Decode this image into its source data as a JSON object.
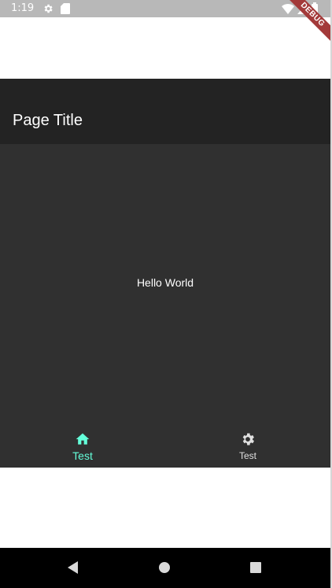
{
  "status_bar": {
    "time": "1:19",
    "icons": [
      "gear-icon",
      "sd-card-icon",
      "wifi-icon",
      "signal-icon",
      "battery-icon"
    ]
  },
  "debug_banner": {
    "label": "DEBUG",
    "color": "#a33a3a"
  },
  "app_bar": {
    "title": "Page Title",
    "background": "#232323"
  },
  "body": {
    "text": "Hello World",
    "background": "#303030"
  },
  "bottom_nav": {
    "accent_color": "#64ffda",
    "inactive_color": "#e0e0e0",
    "items": [
      {
        "label": "Test",
        "icon": "home-icon",
        "active": true
      },
      {
        "label": "Test",
        "icon": "settings-icon",
        "active": false
      }
    ]
  },
  "system_nav": {
    "buttons": [
      "back-icon",
      "home-circle-icon",
      "recents-icon"
    ]
  }
}
